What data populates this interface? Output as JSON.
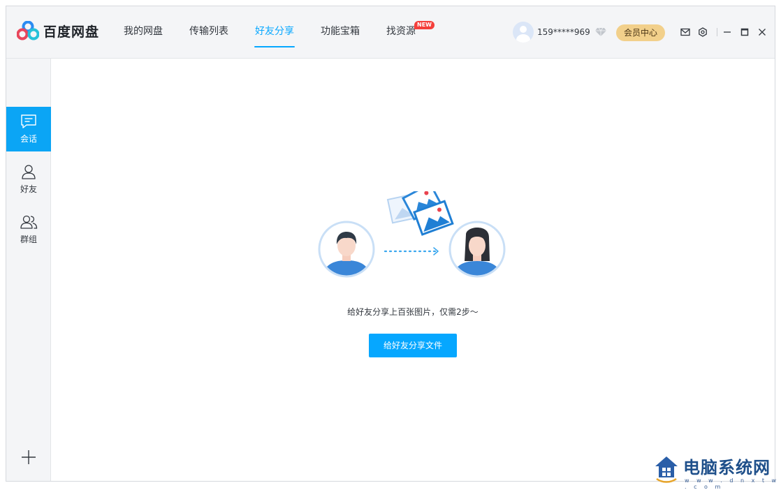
{
  "app": {
    "name": "百度网盘"
  },
  "nav": {
    "items": [
      {
        "label": "我的网盘"
      },
      {
        "label": "传输列表"
      },
      {
        "label": "好友分享",
        "active": true
      },
      {
        "label": "功能宝箱"
      },
      {
        "label": "找资源",
        "badge": "NEW"
      }
    ]
  },
  "user": {
    "name": "159*****969",
    "vip_button": "会员中心"
  },
  "window_controls": {
    "icons": [
      "mail-icon",
      "settings-gear-icon",
      "minimize-icon",
      "maximize-icon",
      "close-icon"
    ]
  },
  "sidebar": {
    "items": [
      {
        "label": "会话",
        "icon": "chat-icon",
        "active": true
      },
      {
        "label": "好友",
        "icon": "person-icon"
      },
      {
        "label": "群组",
        "icon": "group-icon"
      }
    ],
    "add_icon": "plus-icon"
  },
  "main": {
    "tip": "给好友分享上百张图片，仅需2步～",
    "share_button": "给好友分享文件"
  },
  "watermark": {
    "title": "电脑系统网",
    "url": "w w w . d n x t w . c o m"
  },
  "colors": {
    "accent": "#06a7ff",
    "vip": "#f2d08b",
    "badge": "#f43f3b"
  }
}
